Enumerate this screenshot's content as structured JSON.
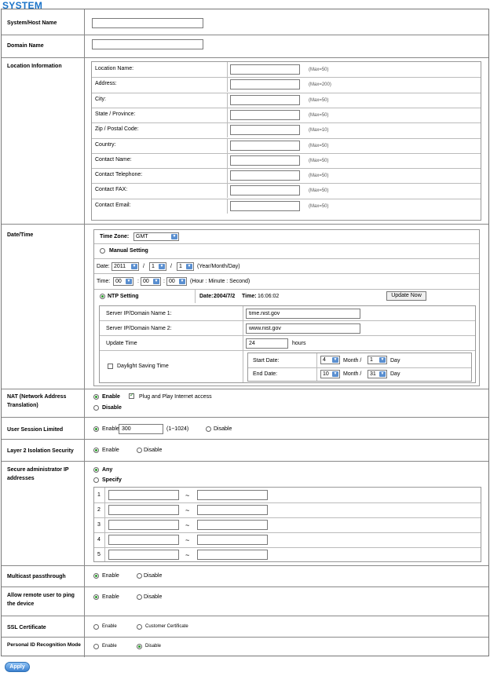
{
  "page_title": "SYSTEM",
  "host": {
    "label": "System/Host Name",
    "value": ""
  },
  "domain": {
    "label": "Domain Name",
    "value": ""
  },
  "location": {
    "label": "Location Information",
    "fields": [
      {
        "label": "Location Name:",
        "hint": "(Max=50)"
      },
      {
        "label": "Address:",
        "hint": "(Max=200)"
      },
      {
        "label": "City:",
        "hint": "(Max=50)"
      },
      {
        "label": "State / Province:",
        "hint": "(Max=50)"
      },
      {
        "label": "Zip / Postal Code:",
        "hint": "(Max=10)"
      },
      {
        "label": "Country:",
        "hint": "(Max=50)"
      },
      {
        "label": "Contact Name:",
        "hint": "(Max=50)"
      },
      {
        "label": "Contact Telephone:",
        "hint": "(Max=50)"
      },
      {
        "label": "Contact FAX:",
        "hint": "(Max=50)"
      },
      {
        "label": "Contact Email:",
        "hint": "(Max=50)"
      }
    ]
  },
  "datetime": {
    "label": "Date/Time",
    "timezone_label": "Time Zone:",
    "timezone": "GMT",
    "manual": "Manual Setting",
    "date_label": "Date:",
    "year": "2011",
    "month": "1",
    "day": "1",
    "date_fmt": "(Year/Month/Day)",
    "slash": "/",
    "time_label": "Time:",
    "hour": "00",
    "minute": "00",
    "second": "00",
    "time_fmt": "(Hour : Minute : Second)",
    "colon": ":",
    "ntp": "NTP Setting",
    "ntp_date_label": "Date:",
    "ntp_date": "2004/7/2",
    "ntp_time_label": "Time:",
    "ntp_time": "16:06:02",
    "update_now": "Update Now",
    "server1_label": "Server IP/Domain Name 1:",
    "server1": "time.nist.gov",
    "server2_label": "Server IP/Domain Name 2:",
    "server2": "www.nist.gov",
    "update_label": "Update Time",
    "update_value": "24",
    "hours": "hours",
    "dst": "Daylight Saving Time",
    "start_label": "Start Date:",
    "start_month": "4",
    "start_day": "1",
    "end_label": "End Date:",
    "end_month": "10",
    "end_day": "31",
    "month_word": "Month /",
    "day_word": "Day"
  },
  "nat": {
    "label": "NAT (Network Address Translation)",
    "enable": "Enable",
    "disable": "Disable",
    "plug": "Plug and Play Internet access"
  },
  "session": {
    "label": "User Session Limited",
    "enable": "Enable",
    "value": "300",
    "range": "(1~1024)",
    "disable": "Disable"
  },
  "isolation": {
    "label": "Layer 2 Isolation Security",
    "enable": "Enable",
    "disable": "Disable"
  },
  "secure": {
    "label": "Secure administrator IP addresses",
    "any": "Any",
    "specify": "Specify",
    "rows": [
      "1",
      "2",
      "3",
      "4",
      "5"
    ],
    "tilde": "~"
  },
  "multicast": {
    "label": "Multicast passthrough",
    "enable": "Enable",
    "disable": "Disable"
  },
  "ping": {
    "label": "Allow remote user to ping the device",
    "enable": "Enable",
    "disable": "Disable"
  },
  "ssl": {
    "label": "SSL Certificate",
    "enable": "Enable",
    "customer": "Customer Certificate"
  },
  "pid": {
    "label": "Personal ID Recognition Mode",
    "enable": "Enable",
    "disable": "Disable"
  },
  "apply": "Apply"
}
